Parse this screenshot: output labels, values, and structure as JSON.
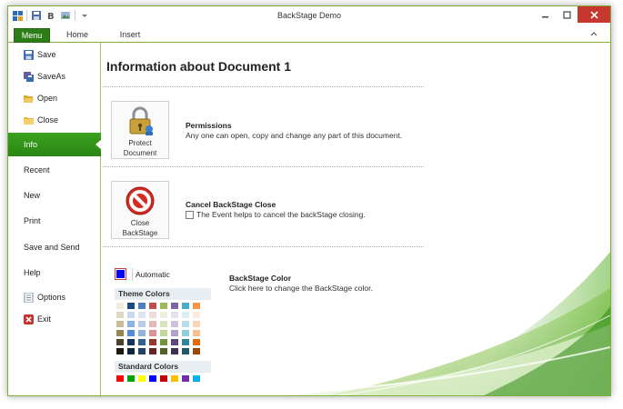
{
  "window": {
    "title": "BackStage Demo"
  },
  "ribbon": {
    "tabs": [
      "Menu",
      "Home",
      "Insert"
    ]
  },
  "sidebar": {
    "items": [
      {
        "label": "Save",
        "icon": "save-icon"
      },
      {
        "label": "SaveAs",
        "icon": "save-as-icon"
      },
      {
        "label": "Open",
        "icon": "folder-open-icon"
      },
      {
        "label": "Close",
        "icon": "folder-close-icon"
      },
      {
        "label": "Info",
        "active": true
      },
      {
        "label": "Recent"
      },
      {
        "label": "New"
      },
      {
        "label": "Print"
      },
      {
        "label": "Save and Send"
      },
      {
        "label": "Help"
      },
      {
        "label": "Options",
        "icon": "options-icon"
      },
      {
        "label": "Exit",
        "icon": "exit-icon"
      }
    ]
  },
  "main": {
    "title": "Information about Document 1",
    "permissions": {
      "button_line1": "Protect",
      "button_line2": "Document",
      "icon": "padlock-icon",
      "title": "Permissions",
      "description": "Any one can open, copy and change any part of this document."
    },
    "cancel_close": {
      "button_line1": "Close",
      "button_line2": "BackStage",
      "icon": "stop-sign-icon",
      "title": "Cancel BackStage Close",
      "checkbox_label": "The Event helps to cancel the backStage closing.",
      "checked": false
    },
    "color": {
      "automatic_label": "Automatic",
      "automatic_color": "#0000ff",
      "theme_colors_label": "Theme Colors",
      "standard_colors_label": "Standard Colors",
      "title": "BackStage Color",
      "description": "Click here to change the BackStage color.",
      "theme_colors": [
        [
          "#ffffff",
          "#000000",
          "#eeece1",
          "#1f497d",
          "#4f81bd",
          "#c0504d",
          "#9bbb59",
          "#8064a2",
          "#4bacc6",
          "#f79646"
        ],
        [
          "#f2f2f2",
          "#7f7f7f",
          "#ddd9c3",
          "#c6d9f0",
          "#dbe5f1",
          "#f2dcdb",
          "#ebf1dd",
          "#e5e0ec",
          "#dbeef3",
          "#fdeada"
        ],
        [
          "#d8d8d8",
          "#595959",
          "#c4bd97",
          "#8db3e2",
          "#b8cce4",
          "#e5b9b7",
          "#d7e3bc",
          "#ccc1d9",
          "#b7dde8",
          "#fbd5b5"
        ],
        [
          "#bfbfbf",
          "#3f3f3f",
          "#938953",
          "#548dd4",
          "#95b3d7",
          "#d99694",
          "#c3d69b",
          "#b2a2c7",
          "#92cddc",
          "#fac08f"
        ],
        [
          "#a5a5a5",
          "#262626",
          "#494429",
          "#17365d",
          "#366092",
          "#953734",
          "#76923c",
          "#5f497a",
          "#31859b",
          "#e36c09"
        ],
        [
          "#7f7f7f",
          "#0c0c0c",
          "#1d1b10",
          "#0f243e",
          "#244061",
          "#632423",
          "#4f6128",
          "#3f3151",
          "#205867",
          "#974806"
        ]
      ],
      "standard_colors": [
        "#ff0000",
        "#00a000",
        "#ffff00",
        "#0000ff",
        "#c00000",
        "#ffc000",
        "#7030a0",
        "#00b0f0"
      ]
    }
  },
  "colors": {
    "accent": "#2c7d16",
    "close_button": "#c7372f"
  }
}
